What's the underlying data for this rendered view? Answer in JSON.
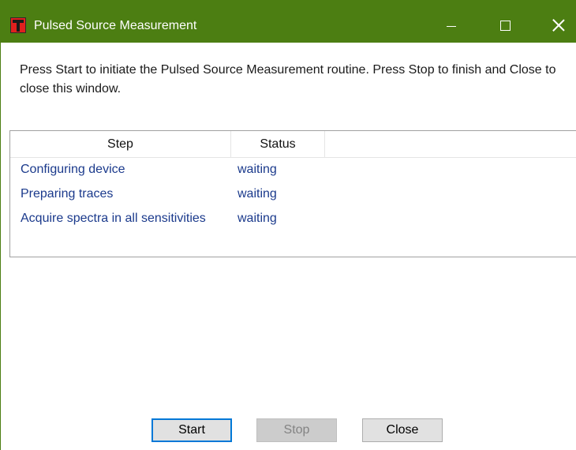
{
  "window": {
    "title": "Pulsed Source Measurement",
    "accent_color": "#4c7e12",
    "icon": "app-logo-icon",
    "controls": {
      "minimize_icon": "minimize-icon",
      "maximize_icon": "maximize-icon",
      "close_icon": "close-icon"
    }
  },
  "instructions": "Press Start to initiate the Pulsed Source Measurement routine. Press Stop to finish and Close to close this window.",
  "table": {
    "columns": [
      "Step",
      "Status"
    ],
    "rows": [
      {
        "step": "Configuring device",
        "status": "waiting"
      },
      {
        "step": "Preparing traces",
        "status": "waiting"
      },
      {
        "step": "Acquire spectra in all sensitivities",
        "status": "waiting"
      }
    ],
    "text_color": "#1b3a8c"
  },
  "buttons": {
    "start": {
      "label": "Start",
      "enabled": true
    },
    "stop": {
      "label": "Stop",
      "enabled": false
    },
    "close": {
      "label": "Close",
      "enabled": true
    }
  }
}
